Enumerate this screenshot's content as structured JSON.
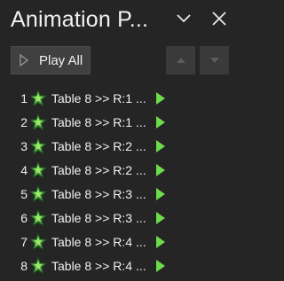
{
  "pane": {
    "title": "Animation P...",
    "play_all_label": "Play All"
  },
  "icons": {
    "dropdown": "chevron-down-icon",
    "close": "close-icon",
    "play": "play-icon",
    "move_up": "triangle-up-icon",
    "move_down": "triangle-down-icon",
    "effect": "green-star-entrance-icon",
    "timing": "green-play-triangle-icon"
  },
  "colors": {
    "background": "#252525",
    "effect_green": "#4caf50",
    "timing_green": "#6ddc4a"
  },
  "animations": [
    {
      "number": "1",
      "label": "Table 8 >> R:1 ..."
    },
    {
      "number": "2",
      "label": "Table 8 >> R:1 ..."
    },
    {
      "number": "3",
      "label": "Table 8 >> R:2 ..."
    },
    {
      "number": "4",
      "label": "Table 8 >> R:2 ..."
    },
    {
      "number": "5",
      "label": "Table 8 >> R:3 ..."
    },
    {
      "number": "6",
      "label": "Table 8 >> R:3 ..."
    },
    {
      "number": "7",
      "label": "Table 8 >> R:4 ..."
    },
    {
      "number": "8",
      "label": "Table 8 >> R:4 ..."
    }
  ]
}
